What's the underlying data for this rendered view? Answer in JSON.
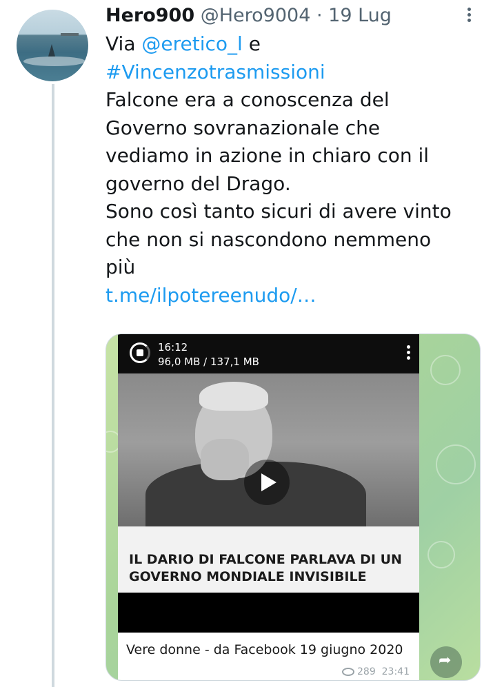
{
  "tweet": {
    "author_name": "Hero900",
    "author_handle": "@Hero9004",
    "separator": "·",
    "date": "19 Lug",
    "line1_prefix": "Via ",
    "mention": "@eretico_l",
    "line1_suffix": "  e",
    "hashtag": "#Vincenzotrasmissioni",
    "body_lines": [
      "Falcone era a conoscenza del",
      "Governo sovranazionale che",
      "vediamo in azione in chiaro con il",
      "governo del Drago.",
      "Sono così  tanto sicuri di avere vinto",
      "che non si nascondono nemmeno",
      "più"
    ],
    "link": "t.me/ilpotereenudo/…"
  },
  "media": {
    "video_time": "16:12",
    "video_size": "96,0 MB / 137,1 MB",
    "caption": "IL DARIO DI FALCONE PARLAVA DI UN GOVERNO MONDIALE INVISIBILE",
    "message_text": "Vere donne  -  da Facebook 19 giugno 2020",
    "views": "289",
    "time": "23:41"
  },
  "icons": {
    "more": "more-icon",
    "loader": "download-progress-icon",
    "play": "play-icon",
    "share": "share-icon",
    "views": "eye-icon"
  },
  "colors": {
    "link": "#1d9bf0",
    "secondary_text": "#536471",
    "telegram_bg": "#a9d49a"
  }
}
